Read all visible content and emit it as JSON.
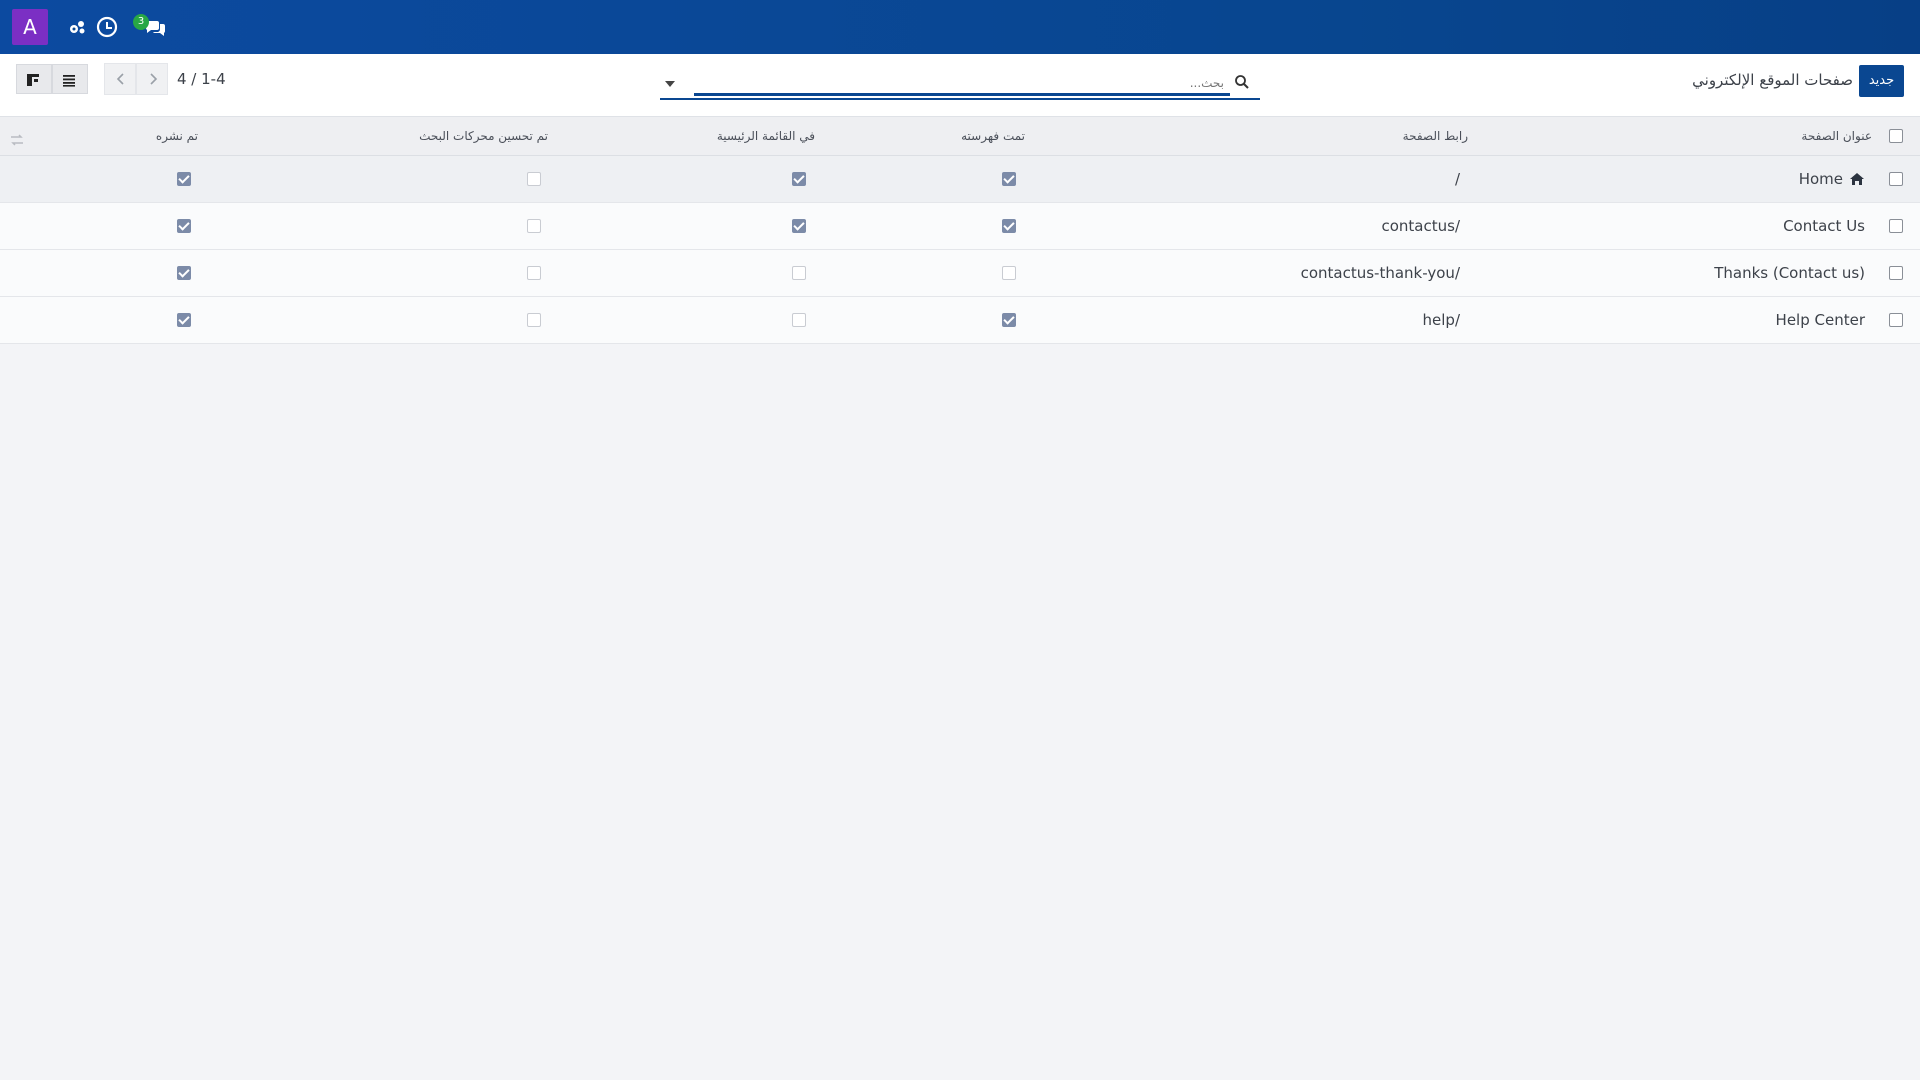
{
  "topbar": {
    "avatar_letter": "A",
    "message_count": "3",
    "icons": [
      "apps-icon",
      "clock-icon",
      "chat-icon"
    ]
  },
  "controlbar": {
    "new_label": "جديد",
    "breadcrumb": "صفحات الموقع الإلكتروني",
    "search_placeholder": "بحث...",
    "pager": "4 / 1-4"
  },
  "table": {
    "headers": {
      "title": "عنوان الصفحة",
      "url": "رابط الصفحة",
      "indexed": "تمت فهرسته",
      "in_menu": "في القائمة الرئيسية",
      "seo": "تم تحسين محركات البحث",
      "published": "تم نشره"
    },
    "rows": [
      {
        "title": "Home",
        "url": "/",
        "indexed": true,
        "in_menu": true,
        "seo": false,
        "published": true
      },
      {
        "title": "Contact Us",
        "url": "/contactus",
        "indexed": true,
        "in_menu": true,
        "seo": false,
        "published": true
      },
      {
        "title": "Thanks (Contact us)",
        "url": "/contactus-thank-you",
        "indexed": false,
        "in_menu": false,
        "seo": false,
        "published": true
      },
      {
        "title": "Help Center",
        "url": "/help",
        "indexed": true,
        "in_menu": false,
        "seo": false,
        "published": true
      }
    ]
  },
  "colors": {
    "topbar": "#0a4791",
    "avatar": "#7b2fc4",
    "badge": "#28a745",
    "checked": "#7c8ba8"
  }
}
